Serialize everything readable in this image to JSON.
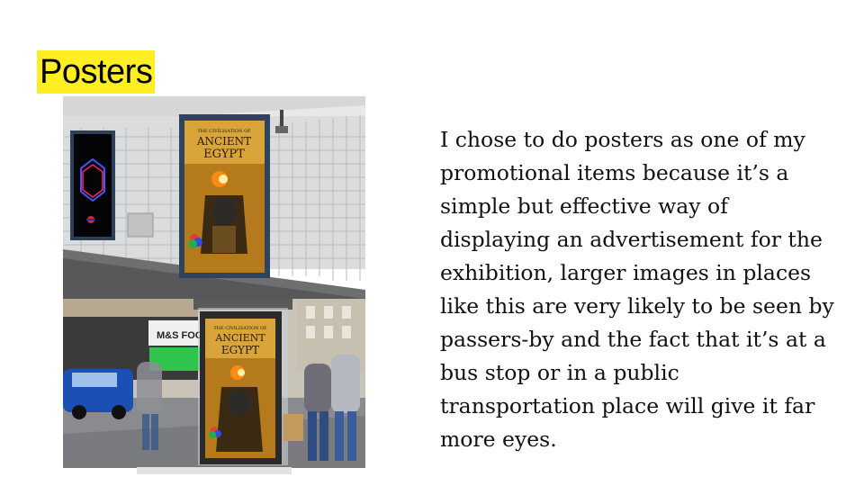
{
  "slide": {
    "title": "Posters",
    "body": "I chose to do posters as one of my promotional items because it’s a simple but effective way of displaying an advertisement for the exhibition, larger images in places like this are very likely to be seen by passers-by and the fact that it’s at a bus stop or in a public transportation place will give it far more eyes."
  },
  "photos": {
    "subway": {
      "poster_title_small": "THE CIVILISATION OF",
      "poster_title_line1": "ANCIENT",
      "poster_title_line2": "EGYPT"
    },
    "bus_stop": {
      "shop_sign": "M&S FOODH",
      "poster_title_small": "THE CIVILISATION OF",
      "poster_title_line1": "ANCIENT",
      "poster_title_line2": "EGYPT"
    }
  },
  "colors": {
    "title_highlight": "#ffee22",
    "poster_gold": "#c8962a"
  }
}
